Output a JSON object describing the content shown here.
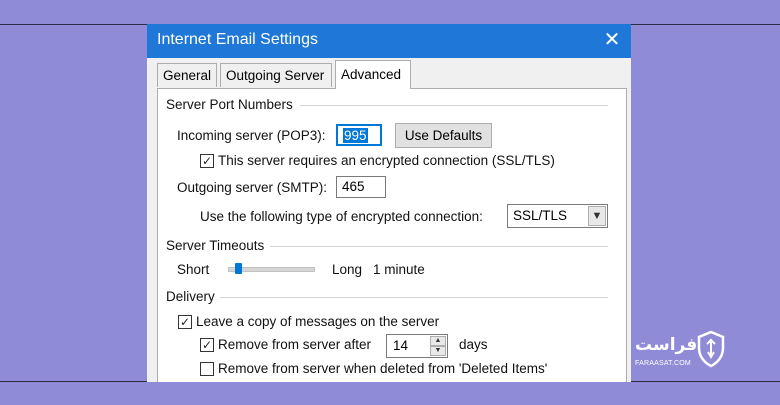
{
  "window": {
    "title": "Internet Email Settings",
    "close_glyph": "✕"
  },
  "tabs": [
    {
      "label": "General",
      "active": false
    },
    {
      "label": "Outgoing Server",
      "active": false
    },
    {
      "label": "Advanced",
      "active": true
    }
  ],
  "server_ports": {
    "group_label": "Server Port Numbers",
    "incoming_label": "Incoming server (POP3):",
    "incoming_value": "995",
    "use_defaults_label": "Use Defaults",
    "ssl_checkbox_label": "This server requires an encrypted connection (SSL/TLS)",
    "ssl_checked": true,
    "outgoing_label": "Outgoing server (SMTP):",
    "outgoing_value": "465",
    "encryption_label": "Use the following type of encrypted connection:",
    "encryption_value": "SSL/TLS"
  },
  "timeouts": {
    "group_label": "Server Timeouts",
    "short_label": "Short",
    "long_label": "Long",
    "value_text": "1 minute",
    "slider_fraction": 0.12
  },
  "delivery": {
    "group_label": "Delivery",
    "leave_copy_label": "Leave a copy of messages on the server",
    "leave_copy_checked": true,
    "remove_after_label": "Remove from server after",
    "remove_after_checked": true,
    "remove_after_value": "14",
    "days_label": "days",
    "remove_deleted_label": "Remove from server when deleted from 'Deleted Items'",
    "remove_deleted_checked": false
  },
  "watermark": {
    "name": "فراست",
    "url": "FARAASAT.COM"
  },
  "colors": {
    "background": "#8f8bd6",
    "titlebar": "#1f78d7",
    "accent": "#0078d7"
  }
}
